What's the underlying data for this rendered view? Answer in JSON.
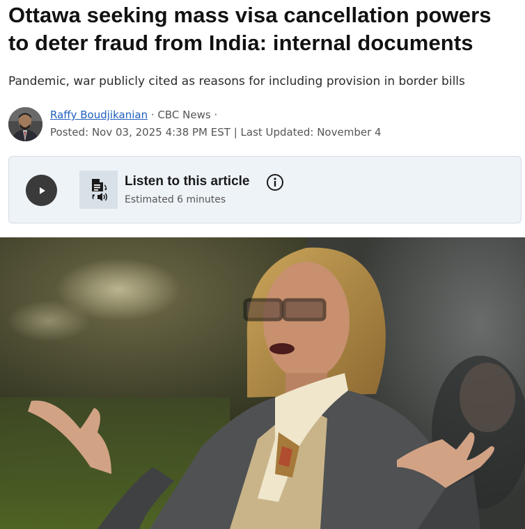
{
  "article": {
    "headline_line1": "Ottawa seeking mass visa cancellation powers",
    "headline_line2": "to deter fraud from India: internal documents",
    "deck": "Pandemic, war publicly cited as reasons for including provision in border bills"
  },
  "byline": {
    "author": "Raffy Boudjikanian",
    "separator1": " · ",
    "outlet": "CBC News",
    "separator2": " ·",
    "posted": "Posted: Nov 03, 2025 4:38 PM EST | Last Updated: November 4"
  },
  "audio": {
    "title": "Listen to this article",
    "estimate": "Estimated 6 minutes",
    "play_icon": "play-icon",
    "tts_icon": "document-audio-icon",
    "info_icon": "info-icon"
  },
  "colors": {
    "link": "#1f5fbf",
    "card_bg": "#eef3f8",
    "play_bg": "#3a3a3a"
  }
}
